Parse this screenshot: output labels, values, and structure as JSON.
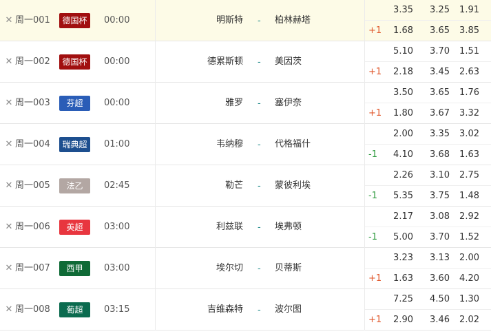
{
  "colors": {
    "highlight_row": "#fdfbe7",
    "handicap_positive": "#e0562a",
    "handicap_negative": "#2e9a3e",
    "vs_dash": "#1f8a8a"
  },
  "icons": {
    "remove": "close-icon"
  },
  "matches": [
    {
      "id": "周一001",
      "league": "德国杯",
      "league_color": "#a10f0f",
      "time": "00:00",
      "home": "明斯特",
      "vs": "-",
      "away": "柏林赫塔",
      "odds": [
        "3.35",
        "3.25",
        "1.91"
      ],
      "handicap": "+1",
      "handicap_odds": [
        "1.68",
        "3.65",
        "3.85"
      ]
    },
    {
      "id": "周一002",
      "league": "德国杯",
      "league_color": "#a10f0f",
      "time": "00:00",
      "home": "德累斯顿",
      "vs": "-",
      "away": "美因茨",
      "odds": [
        "5.10",
        "3.70",
        "1.51"
      ],
      "handicap": "+1",
      "handicap_odds": [
        "2.18",
        "3.45",
        "2.63"
      ]
    },
    {
      "id": "周一003",
      "league": "芬超",
      "league_color": "#2a5db7",
      "time": "00:00",
      "home": "雅罗",
      "vs": "-",
      "away": "塞伊奈",
      "odds": [
        "3.50",
        "3.65",
        "1.76"
      ],
      "handicap": "+1",
      "handicap_odds": [
        "1.80",
        "3.67",
        "3.32"
      ]
    },
    {
      "id": "周一004",
      "league": "瑞典超",
      "league_color": "#1d4f8f",
      "time": "01:00",
      "home": "韦纳穆",
      "vs": "-",
      "away": "代格福什",
      "odds": [
        "2.00",
        "3.35",
        "3.02"
      ],
      "handicap": "-1",
      "handicap_odds": [
        "4.10",
        "3.68",
        "1.63"
      ]
    },
    {
      "id": "周一005",
      "league": "法乙",
      "league_color": "#b3a7a3",
      "time": "02:45",
      "home": "勒芒",
      "vs": "-",
      "away": "蒙彼利埃",
      "odds": [
        "2.26",
        "3.10",
        "2.75"
      ],
      "handicap": "-1",
      "handicap_odds": [
        "5.35",
        "3.75",
        "1.48"
      ]
    },
    {
      "id": "周一006",
      "league": "英超",
      "league_color": "#e8363f",
      "time": "03:00",
      "home": "利兹联",
      "vs": "-",
      "away": "埃弗顿",
      "odds": [
        "2.17",
        "3.08",
        "2.92"
      ],
      "handicap": "-1",
      "handicap_odds": [
        "5.00",
        "3.70",
        "1.52"
      ]
    },
    {
      "id": "周一007",
      "league": "西甲",
      "league_color": "#0f6a36",
      "time": "03:00",
      "home": "埃尔切",
      "vs": "-",
      "away": "贝蒂斯",
      "odds": [
        "3.23",
        "3.13",
        "2.00"
      ],
      "handicap": "+1",
      "handicap_odds": [
        "1.63",
        "3.60",
        "4.20"
      ]
    },
    {
      "id": "周一008",
      "league": "葡超",
      "league_color": "#0b6b4f",
      "time": "03:15",
      "home": "吉维森特",
      "vs": "-",
      "away": "波尔图",
      "odds": [
        "7.25",
        "4.50",
        "1.30"
      ],
      "handicap": "+1",
      "handicap_odds": [
        "2.90",
        "3.46",
        "2.02"
      ]
    }
  ]
}
